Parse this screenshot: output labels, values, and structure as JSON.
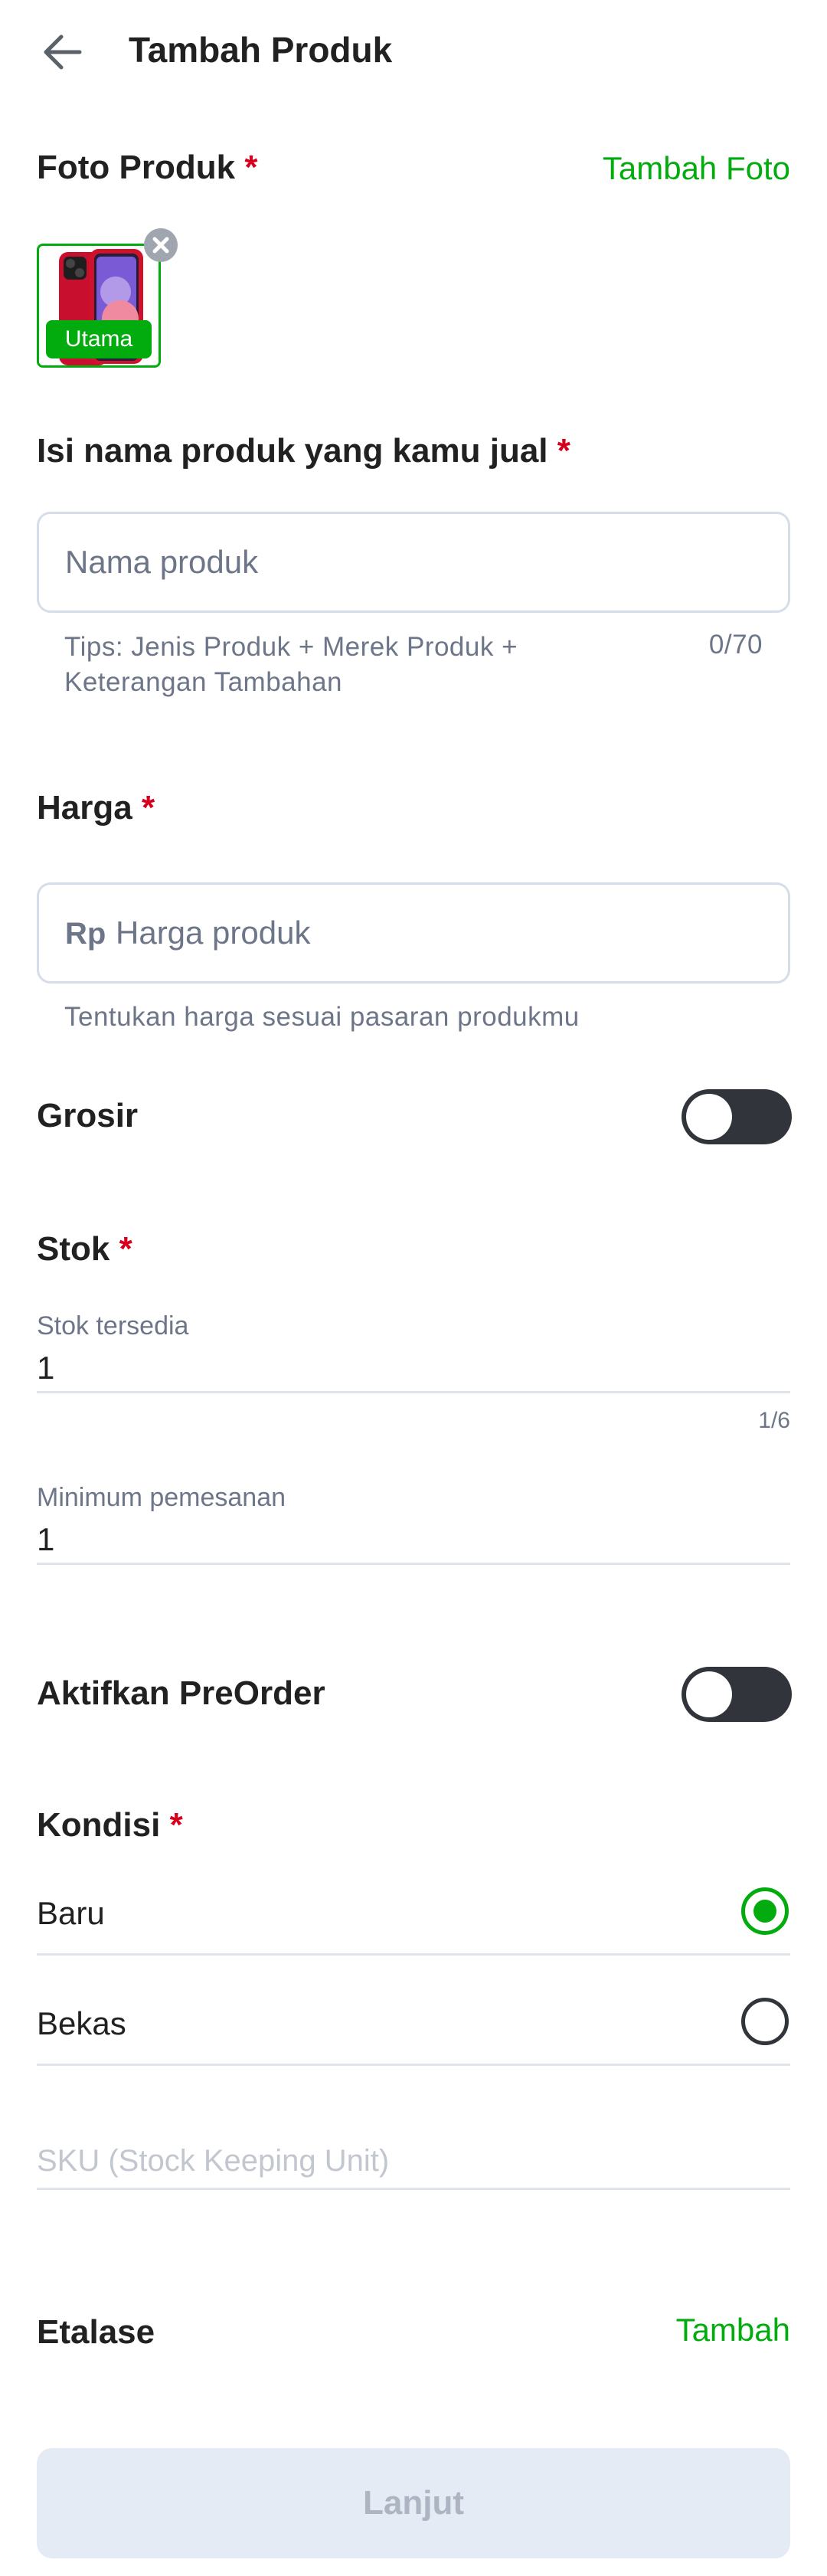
{
  "header": {
    "title": "Tambah Produk"
  },
  "photo": {
    "label": "Foto Produk",
    "required": "*",
    "add_label": "Tambah Foto",
    "badge": "Utama"
  },
  "name": {
    "label": "Isi nama produk yang kamu jual",
    "required": "*",
    "placeholder": "Nama produk",
    "tips_line1": "Tips: Jenis Produk + Merek Produk +",
    "tips_line2": "Keterangan Tambahan",
    "counter": "0/70"
  },
  "price": {
    "label": "Harga",
    "required": "*",
    "prefix": "Rp",
    "placeholder": "Harga produk",
    "helper": "Tentukan harga sesuai pasaran produkmu"
  },
  "grosir": {
    "label": "Grosir",
    "enabled": false
  },
  "stock": {
    "label": "Stok",
    "required": "*",
    "available_label": "Stok tersedia",
    "available_value": "1",
    "available_counter": "1/6",
    "min_label": "Minimum pemesanan",
    "min_value": "1"
  },
  "preorder": {
    "label": "Aktifkan PreOrder",
    "enabled": false
  },
  "condition": {
    "label": "Kondisi",
    "required": "*",
    "options": [
      {
        "label": "Baru",
        "selected": true
      },
      {
        "label": "Bekas",
        "selected": false
      }
    ]
  },
  "sku": {
    "placeholder": "SKU (Stock Keeping Unit)"
  },
  "etalase": {
    "label": "Etalase",
    "add_label": "Tambah"
  },
  "footer": {
    "next_label": "Lanjut"
  },
  "colors": {
    "accent": "#03ac0e",
    "required": "#d6001c",
    "toggle_off": "#31353b",
    "button_disabled": "#e4ebf5"
  }
}
